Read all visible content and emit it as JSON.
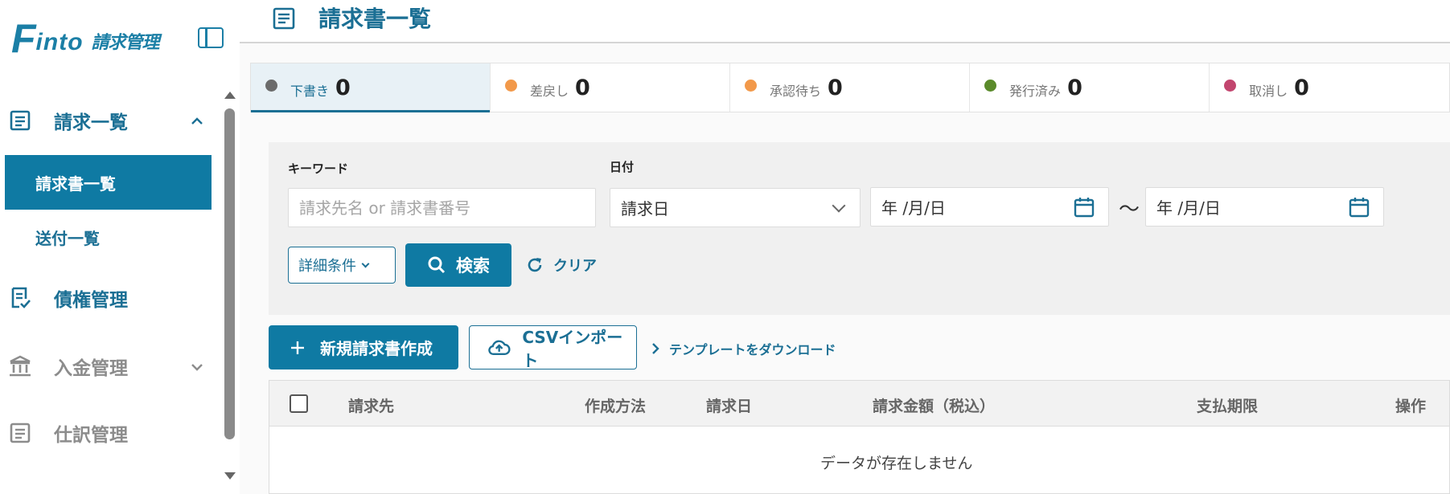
{
  "sidebar": {
    "logo_brand_first": "F",
    "logo_brand_rest": "into",
    "logo_product": "請求管理",
    "nav": [
      {
        "label": "請求一覧",
        "icon": "document-list-icon",
        "state": "expanded"
      },
      {
        "label": "債権管理",
        "icon": "receivable-check-icon"
      },
      {
        "label": "入金管理",
        "icon": "bank-icon",
        "state": "collapsed"
      },
      {
        "label": "仕訳管理",
        "icon": "journal-icon"
      }
    ],
    "sub_items": [
      {
        "label": "請求書一覧",
        "active": true
      },
      {
        "label": "送付一覧",
        "active": false
      }
    ]
  },
  "header": {
    "title": "請求書一覧",
    "icon": "document-list-icon"
  },
  "status_tabs": [
    {
      "label": "下書き",
      "count": "0",
      "color": "#6b6b6b",
      "active": true
    },
    {
      "label": "差戻し",
      "count": "0",
      "color": "#f2994a",
      "active": false
    },
    {
      "label": "承認待ち",
      "count": "0",
      "color": "#f2994a",
      "active": false
    },
    {
      "label": "発行済み",
      "count": "0",
      "color": "#5a8a2a",
      "active": false
    },
    {
      "label": "取消し",
      "count": "0",
      "color": "#c2456e",
      "active": false
    }
  ],
  "filters": {
    "keyword_label": "キーワード",
    "keyword_placeholder": "請求先名 or 請求書番号",
    "date_label": "日付",
    "date_type_selected": "請求日",
    "date_from_placeholder": "年 /月/日",
    "date_to_placeholder": "年 /月/日",
    "range_separator": "〜",
    "detail_button": "詳細条件",
    "search_button": "検索",
    "clear_button": "クリア"
  },
  "actions": {
    "new_invoice": "新規請求書作成",
    "csv_import": "CSVインポート",
    "template_download": "テンプレートをダウンロード"
  },
  "table": {
    "columns": [
      "請求先",
      "作成方法",
      "請求日",
      "請求金額（税込）",
      "支払期限",
      "操作"
    ],
    "empty_message": "データが存在しません"
  },
  "colors": {
    "primary": "#0f7aa3",
    "primary_text": "#1b6f94",
    "inactive_text": "#8c8c8c"
  }
}
